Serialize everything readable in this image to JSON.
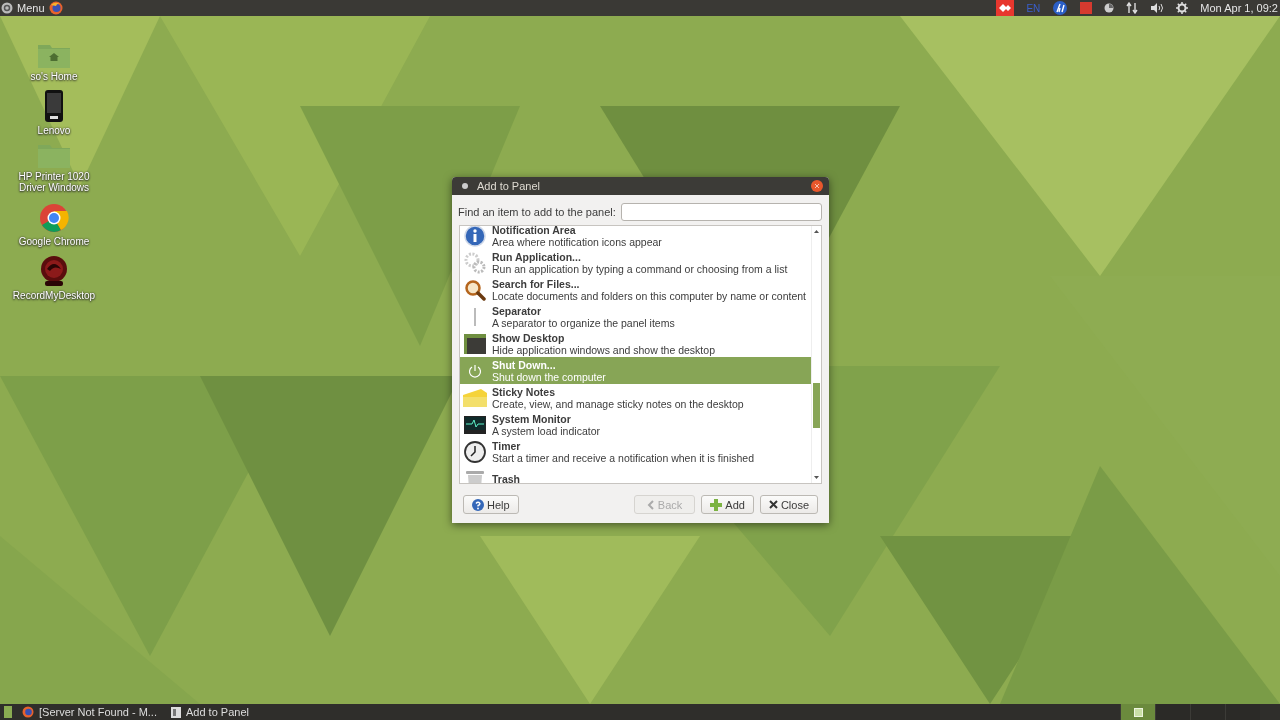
{
  "top_panel": {
    "menu_label": "Menu",
    "keyboard_layout": "EN",
    "clock": "Mon Apr 1, 09:2"
  },
  "desktop_icons": [
    {
      "label": "so's Home"
    },
    {
      "label": "Lenovo"
    },
    {
      "label": "HP Printer 1020 Driver Windows"
    },
    {
      "label": "Google Chrome"
    },
    {
      "label": "RecordMyDesktop"
    }
  ],
  "dialog": {
    "title": "Add to Panel",
    "search_label": "Find an item to add to the panel:",
    "items": [
      {
        "title": "Notification Area",
        "description": "Area where notification icons appear",
        "selected": false
      },
      {
        "title": "Run Application...",
        "description": "Run an application by typing a command or choosing from a list",
        "selected": false
      },
      {
        "title": "Search for Files...",
        "description": "Locate documents and folders on this computer by name or content",
        "selected": false
      },
      {
        "title": "Separator",
        "description": "A separator to organize the panel items",
        "selected": false
      },
      {
        "title": "Show Desktop",
        "description": "Hide application windows and show the desktop",
        "selected": false
      },
      {
        "title": "Shut Down...",
        "description": "Shut down the computer",
        "selected": true
      },
      {
        "title": "Sticky Notes",
        "description": "Create, view, and manage sticky notes on the desktop",
        "selected": false
      },
      {
        "title": "System Monitor",
        "description": "A system load indicator",
        "selected": false
      },
      {
        "title": "Timer",
        "description": "Start a timer and receive a notification when it is finished",
        "selected": false
      },
      {
        "title": "Trash",
        "selected": false
      }
    ],
    "buttons": [
      {
        "label": "Help",
        "disabled": false
      },
      {
        "label": "Back",
        "disabled": true
      },
      {
        "label": "Add",
        "disabled": false
      },
      {
        "label": "Close",
        "disabled": false
      }
    ]
  },
  "taskbar": {
    "tasks": [
      {
        "label": "[Server Not Found - M...",
        "selected": false
      },
      {
        "label": "Add to Panel",
        "selected": false
      }
    ],
    "workspaces": [
      {
        "selected": true
      },
      {
        "selected": false
      },
      {
        "selected": false
      },
      {
        "selected": false
      }
    ]
  }
}
